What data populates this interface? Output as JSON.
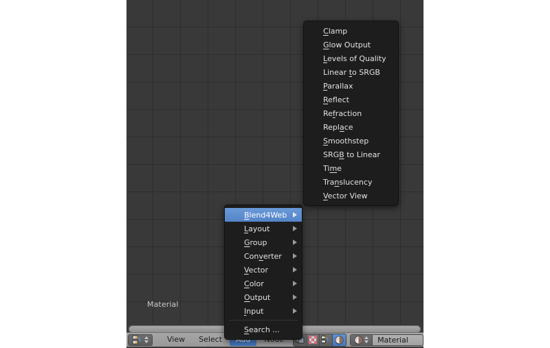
{
  "editor": {
    "canvas_label": "Material",
    "scrollbar_name": "horizontal-scrollbar"
  },
  "toolbar": {
    "editor_type_icon": "node-editor-icon",
    "menus": [
      {
        "label": "View",
        "active": false
      },
      {
        "label": "Select",
        "active": false
      },
      {
        "label": "Add",
        "active": true
      },
      {
        "label": "Node",
        "active": false
      }
    ],
    "toggles": [
      {
        "name": "shading-object-icon",
        "on": false
      },
      {
        "name": "checker-texture-icon",
        "on": false
      },
      {
        "name": "node-tree-icon",
        "on": false
      },
      {
        "name": "material-sphere-icon",
        "on": true
      }
    ],
    "datablock": {
      "icon": "material-sphere-icon",
      "value": "Material"
    }
  },
  "add_menu": {
    "name": "add-menu",
    "items": [
      {
        "label": "Blend4Web",
        "accel": "B",
        "submenu": true,
        "selected": true
      },
      {
        "label": "Layout",
        "accel": "L",
        "submenu": true,
        "selected": false
      },
      {
        "label": "Group",
        "accel": "G",
        "submenu": true,
        "selected": false
      },
      {
        "label": "Converter",
        "accel": "v",
        "submenu": true,
        "selected": false
      },
      {
        "label": "Vector",
        "accel": "V",
        "submenu": true,
        "selected": false
      },
      {
        "label": "Color",
        "accel": "C",
        "submenu": true,
        "selected": false
      },
      {
        "label": "Output",
        "accel": "O",
        "submenu": true,
        "selected": false
      },
      {
        "label": "Input",
        "accel": "I",
        "submenu": true,
        "selected": false
      },
      {
        "label": "Search ...",
        "accel": "S",
        "submenu": false,
        "selected": false
      }
    ]
  },
  "blend4web_submenu": {
    "name": "blend4web-submenu",
    "items": [
      {
        "label": "Clamp",
        "accel": "C"
      },
      {
        "label": "Glow Output",
        "accel": "G"
      },
      {
        "label": "Levels of Quality",
        "accel": "L"
      },
      {
        "label": "Linear to SRGB",
        "accel": "t"
      },
      {
        "label": "Parallax",
        "accel": "P"
      },
      {
        "label": "Reflect",
        "accel": "R"
      },
      {
        "label": "Refraction",
        "accel": "f"
      },
      {
        "label": "Replace",
        "accel": "a"
      },
      {
        "label": "Smoothstep",
        "accel": "S"
      },
      {
        "label": "SRGB to Linear",
        "accel": "B"
      },
      {
        "label": "Time",
        "accel": "m"
      },
      {
        "label": "Translucency",
        "accel": "n"
      },
      {
        "label": "Vector View",
        "accel": "V"
      }
    ]
  },
  "colors": {
    "accent": "#5484c6",
    "canvas": "#393939",
    "menu_bg": "#1d1d1d",
    "toolbar_bg": "#a0a0a0"
  }
}
